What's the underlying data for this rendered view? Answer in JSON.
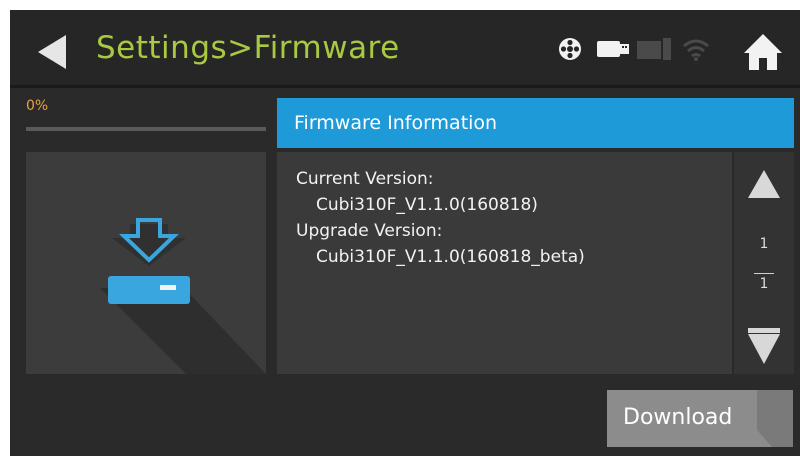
{
  "header": {
    "title": "Settings>Firmware",
    "status_icons": [
      "filament-spool-icon",
      "usb-drive-icon",
      "sd-card-icon",
      "wifi-icon"
    ],
    "accent_color": "#a8c940"
  },
  "progress": {
    "label": "0%",
    "value_percent": 0,
    "color": "#e8a23a"
  },
  "firmware_panel": {
    "title": "Firmware Information",
    "lines": [
      "Current Version:",
      "Cubi310F_V1.1.0(160818)",
      "Upgrade Version:",
      "Cubi310F_V1.1.0(160818_beta)"
    ],
    "header_color": "#1f9ad8"
  },
  "pagination": {
    "current": "1",
    "total": "1"
  },
  "download_label": "Download"
}
